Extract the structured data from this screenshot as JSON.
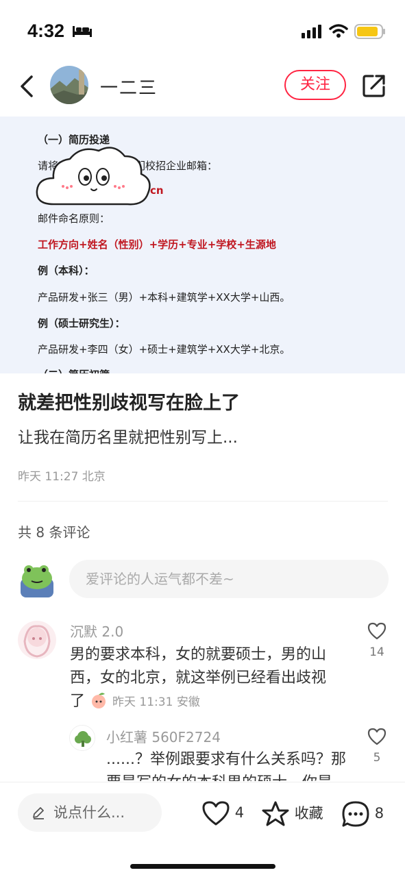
{
  "status_bar": {
    "time": "4:32"
  },
  "nav": {
    "author_name": "一二三",
    "follow_label": "关注"
  },
  "post_image": {
    "section_heading": "（一）简历投递",
    "line_email_prefix": "请将",
    "line_email_suffix": "递至我们校招企业邮箱：",
    "email_visible": "cn",
    "naming_rule_label": "邮件命名原则：",
    "naming_rule": "工作方向+姓名（性别）+学历+专业+学校+生源地",
    "example_bachelor_label": "例（本科）：",
    "example_bachelor": "产品研发+张三（男）+本科+建筑学+XX大学+山西。",
    "example_master_label": "例（硕士研究生）：",
    "example_master": "产品研发+李四（女）+硕士+建筑学+XX大学+北京。",
    "next_heading_partial": "（二）简历初筛"
  },
  "post": {
    "title": "就差把性别歧视写在脸上了",
    "body": "让我在简历名里就把性别写上...",
    "meta": "昨天 11:27 北京"
  },
  "comments_header": {
    "count_label": "共 8 条评论"
  },
  "comment_input": {
    "placeholder": "爱评论的人运气都不差~"
  },
  "comments": [
    {
      "user": "沉默 2.0",
      "text": "男的要求本科，女的就要硕士，男的山西，女的北京，就这举例已经看出歧视了",
      "meta": "昨天 11:31 安徽",
      "likes": "14"
    },
    {
      "user": "小红薯 560F2724",
      "text": "......？举例跟要求有什么关系吗？那要是写的女的本科男的硕士，你是",
      "likes": "5"
    }
  ],
  "bottom_bar": {
    "say_placeholder": "说点什么...",
    "like_count": "4",
    "collect_label": "收藏",
    "comment_count": "8"
  },
  "colors": {
    "accent": "#ff2442",
    "doc_red": "#c0161f",
    "doc_bg": "#eff3fb"
  }
}
